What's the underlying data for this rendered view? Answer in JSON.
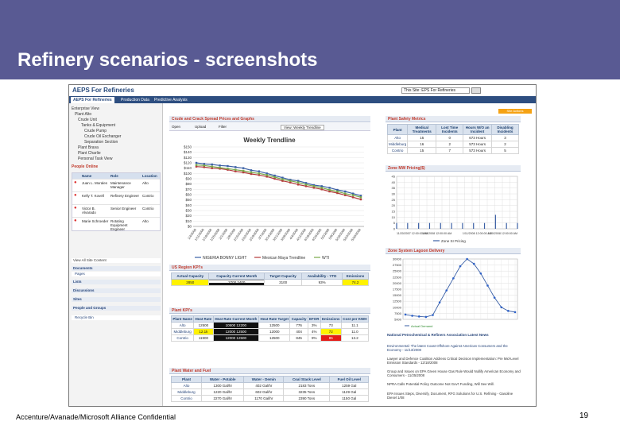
{
  "slide": {
    "title": "Refinery scenarios - screenshots",
    "footer": "Accenture/Avanade/Microsoft Alliance Confidential",
    "page_number": "19"
  },
  "app": {
    "logo": "AEPS For Refineries",
    "site_select": "This Site: EPS For Refineries",
    "site_settings": "Site Actions",
    "tabs": [
      "AEPS For Refineries",
      "Production Data",
      "Predictive Analysis"
    ]
  },
  "sidebar": {
    "tree": [
      "Enterprise View",
      "Plant Alto",
      "Crude Unit",
      "Tanks & Equipment",
      "Crude Pump",
      "Crude Oil Exchanger",
      "Separation Section",
      "Plant Brava",
      "Plant Charlie",
      "Personal Task View"
    ],
    "people_title": "People Online",
    "people_headers": [
      "Name",
      "Role",
      "Location"
    ],
    "people": [
      {
        "name": "Juan L. Morales",
        "role": "Maintenance Manager",
        "location": "Alto"
      },
      {
        "name": "Kelly T. Kovell",
        "role": "Refinery Engineer",
        "location": "Contrio"
      },
      {
        "name": "Victor B. Alvarado",
        "role": "Senior Engineer",
        "location": "Contrio"
      },
      {
        "name": "Marie Schroeder",
        "role": "Rotating Equipment Engineer",
        "location": "Alto"
      }
    ],
    "view_all": "View All Site Content",
    "quick": [
      {
        "head": "Documents",
        "sub": "Pages"
      },
      {
        "head": "Lists",
        "sub": ""
      },
      {
        "head": "Discussions",
        "sub": ""
      },
      {
        "head": "Sites",
        "sub": ""
      },
      {
        "head": "People and Groups",
        "sub": ""
      }
    ],
    "recycle": "Recycle Bin"
  },
  "center": {
    "chart_title_bar": "Crude and Crack Spread Prices and Graphs",
    "toolbar": [
      "Open",
      "Upload",
      "Filter",
      "View: Weekly Trendline"
    ],
    "region_title": "US Region KPI's",
    "region_headers": [
      "Actual Capacity",
      "Capacity Current Month",
      "Target Capacity",
      "Availability - YTD",
      "Emissions"
    ],
    "region_values": [
      "2850",
      "2700  2400",
      "3100",
      "93%",
      "74.2"
    ],
    "plant_title": "Plant KPI's",
    "plant_headers": [
      "Plant Name",
      "Heat Rate",
      "Heat Rate Current Month",
      "Heat Rate Target",
      "Capacity",
      "EFOR",
      "Emissions",
      "Cost per KWH"
    ],
    "plant_rows": [
      [
        "Alto",
        "12500",
        "10500  12200",
        "12500",
        "776",
        "3%",
        "73",
        "11.1"
      ],
      [
        "Middleburg",
        "12.1k",
        "12000  12500",
        "12000",
        "404",
        "4%",
        "72",
        "11.0"
      ],
      [
        "Contrio",
        "11900",
        "12000  12500",
        "12500",
        "845",
        "9%",
        "85",
        "13.2"
      ]
    ],
    "water_title": "Plant Water and Fuel",
    "water_headers": [
      "Plant",
      "Water - Potable",
      "Water - Demin",
      "Coal Stack Level",
      "Fuel Oil Level"
    ],
    "water_rows": [
      [
        "Alto",
        "1300 Gal/hr",
        "402 Gal/hr",
        "2183 Tons",
        "1259 Gal"
      ],
      [
        "Middleburg",
        "1220 Gal/hr",
        "602 Gal/hr",
        "3235 Tons",
        "1129 Gal"
      ],
      [
        "Contrio",
        "2270 Gal/hr",
        "1170 Gal/hr",
        "2390 Tons",
        "1150 Gal"
      ]
    ]
  },
  "chart_data": [
    {
      "type": "line",
      "title": "Weekly Trendline",
      "x": [
        "1/4/2008",
        "1/11/2008",
        "1/18/2008",
        "1/25/2008",
        "2/1/2008",
        "2/8/2008",
        "2/15/2008",
        "2/22/2008",
        "2/29/2008",
        "3/7/2008",
        "3/14/2008",
        "3/21/2008",
        "3/28/2008",
        "4/4/2008",
        "4/11/2008",
        "4/18/2008",
        "4/25/2008",
        "5/2/2008",
        "5/9/2008",
        "5/16/2008",
        "5/23/2008",
        "5/30/2008"
      ],
      "series": [
        {
          "name": "NIGERIA BONNY LIGHT",
          "color": "#3a5fa5",
          "values": [
            120,
            118,
            117,
            115,
            114,
            112,
            110,
            106,
            104,
            100,
            96,
            92,
            88,
            86,
            82,
            78,
            76,
            73,
            69,
            66,
            62,
            58
          ]
        },
        {
          "name": "Mexican Maya Trendline",
          "color": "#b33a3a",
          "values": [
            113,
            112,
            110,
            109,
            107,
            104,
            102,
            99,
            97,
            94,
            90,
            86,
            83,
            79,
            76,
            73,
            70,
            66,
            63,
            59,
            55,
            51
          ]
        },
        {
          "name": "WTI",
          "color": "#79a84a",
          "values": [
            116,
            115,
            113,
            111,
            109,
            107,
            105,
            102,
            100,
            97,
            93,
            89,
            86,
            83,
            79,
            76,
            73,
            69,
            66,
            62,
            59,
            55
          ]
        }
      ],
      "ylim": [
        0,
        150
      ],
      "yticks": [
        "$0",
        "$10",
        "$20",
        "$30",
        "$40",
        "$50",
        "$60",
        "$70",
        "$80",
        "$90",
        "$100",
        "$110",
        "$120",
        "$130",
        "$140",
        "$150"
      ]
    },
    {
      "type": "line",
      "title": "Zone MW Pricing($)",
      "x": [
        "11/20/2007 12:00:00 AM",
        "1/15/2008 12:00:00 AM",
        "1/11/2008 12:00:00 AM",
        "1/20/2008 12:00:00 AM"
      ],
      "series": [
        {
          "name": "Zone SI Pricing",
          "values": [
            5,
            5,
            5,
            5,
            5,
            5,
            5,
            5,
            5,
            12,
            5,
            5
          ]
        }
      ],
      "ylim": [
        0,
        45
      ],
      "yticks": [
        "0",
        "5",
        "10",
        "15",
        "20",
        "25",
        "30",
        "35",
        "40",
        "45"
      ]
    },
    {
      "type": "line",
      "title": "Zone System Lagoon Delivery",
      "series": [
        {
          "name": "Actual Demand",
          "values": [
            7000,
            6500,
            6200,
            6000,
            6800,
            12000,
            17000,
            22000,
            27000,
            30000,
            28000,
            24000,
            19000,
            14000,
            10000,
            8500,
            8000
          ]
        }
      ],
      "ylim": [
        0,
        30000
      ],
      "yticks": [
        "5000",
        "7500",
        "10000",
        "12500",
        "15000",
        "17500",
        "20000",
        "22500",
        "25000",
        "27500",
        "30000"
      ]
    }
  ],
  "right": {
    "safety_title": "Plant Safety Metrics",
    "safety_headers": [
      "Plant",
      "Medical Treatments",
      "Lost Time Incidents",
      "Hours W/O an Incident",
      "Disabling Incidents"
    ],
    "safety_rows": [
      [
        "Alto",
        "15",
        "0",
        "673 Hours",
        "3"
      ],
      [
        "Middleburg",
        "16",
        "2",
        "573 Hours",
        "2"
      ],
      [
        "Contrio",
        "15",
        "7",
        "573 Hours",
        "5"
      ]
    ],
    "pricing_title": "Zone MW Pricing($)",
    "pricing_legend": "Zone SI Pricing",
    "demand_title": "Zone System Lagoon Delivery",
    "news_title": "National Petrochemical & Refiners Association Latest News",
    "news": [
      "Environmental: The latest Coast Offshore Against American Consumers and the Economy - 11/13/2008",
      "Lawyer and Defence Coalition Address Critical Decision Implementation: Pre Mid-Level Emission Standards - 12/18/2008",
      "Group and Issues on EPA Green House Gas Rule Would Nullify American Economy and Consumers - 11/25/2008",
      "NPRA Calls Potential Policy Outcome Not Gov't Funding, Will See Will.",
      "EPA Issues Steps, Diversify, Document, RFG Solutions for U.S. Refining - Gasoline Diesel 1/08"
    ]
  }
}
